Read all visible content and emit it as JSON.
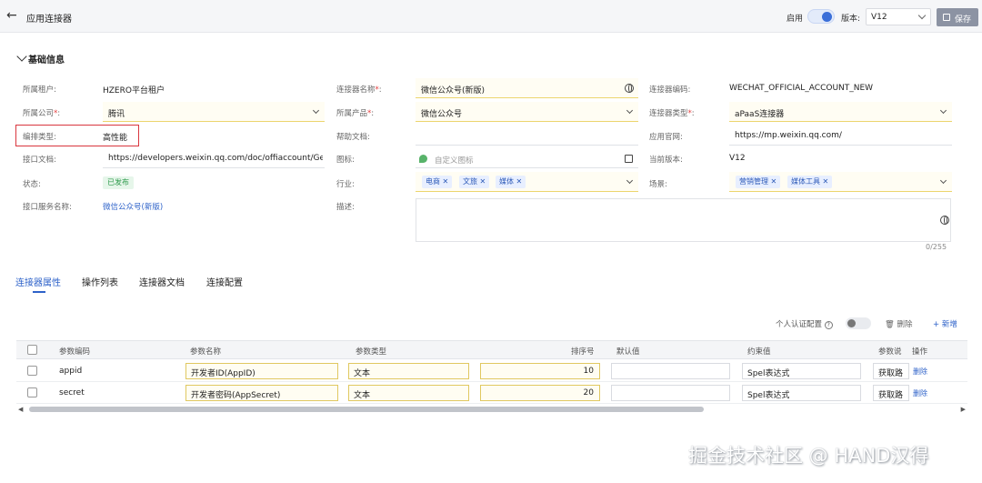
{
  "header": {
    "title": "应用连接器",
    "enable_label": "启用",
    "version_label": "版本:",
    "version_value": "V12",
    "save_label": "保存"
  },
  "section": {
    "title": "基础信息"
  },
  "fields": {
    "tenant": {
      "label": "所属租户:",
      "value": "HZERO平台租户"
    },
    "connector_name": {
      "label": "连接器名称",
      "value": "微信公众号(新版)"
    },
    "connector_code": {
      "label": "连接器编码:",
      "value": "WECHAT_OFFICIAL_ACCOUNT_NEW"
    },
    "company": {
      "label": "所属公司",
      "value": "腾讯"
    },
    "product": {
      "label": "所属产品",
      "value": "微信公众号"
    },
    "connector_type": {
      "label": "连接器类型",
      "value": "aPaaS连接器"
    },
    "orchestration_type": {
      "label": "编排类型:",
      "value": "高性能"
    },
    "help_doc": {
      "label": "帮助文档:"
    },
    "website": {
      "label": "应用官网:",
      "value": "https://mp.weixin.qq.com/"
    },
    "api_doc": {
      "label": "接口文档:",
      "value": "https://developers.weixin.qq.com/doc/offiaccount/Gettir"
    },
    "icon": {
      "label": "图标:",
      "placeholder": "自定义图标"
    },
    "current_version": {
      "label": "当前版本:",
      "value": "V12"
    },
    "status": {
      "label": "状态:",
      "value": "已发布"
    },
    "industry": {
      "label": "行业:",
      "tags": [
        "电商",
        "文旅",
        "媒体"
      ]
    },
    "scenario": {
      "label": "场景:",
      "tags": [
        "营销管理",
        "媒体工具"
      ]
    },
    "service_name": {
      "label": "接口服务名称:",
      "value": "微信公众号(新版)"
    },
    "description": {
      "label": "描述:",
      "counter": "0/255"
    }
  },
  "required_mark": "*",
  "colon": ":",
  "tabs": [
    "连接器属性",
    "操作列表",
    "连接器文档",
    "连接配置"
  ],
  "table_toolbar": {
    "personal_auth_label": "个人认证配置",
    "help_icon": "?",
    "delete_label": "删除",
    "new_label": "+ 新增"
  },
  "table": {
    "columns": [
      "参数编码",
      "参数名称",
      "参数类型",
      "排序号",
      "默认值",
      "约束值",
      "参数说",
      "操作"
    ],
    "rows": [
      {
        "code": "appid",
        "name": "开发者ID(AppID)",
        "type": "文本",
        "order": "10",
        "default": "",
        "constraint": "Spel表达式",
        "desc": "获取路",
        "action": "删除"
      },
      {
        "code": "secret",
        "name": "开发者密码(AppSecret)",
        "type": "文本",
        "order": "20",
        "default": "",
        "constraint": "Spel表达式",
        "desc": "获取路",
        "action": "删除"
      }
    ]
  },
  "watermark": "掘金技术社区 @ HAND汉得",
  "icons": [
    "back-arrow-icon",
    "save-icon",
    "globe-icon",
    "chevron-down-icon",
    "image-icon",
    "edit-icon",
    "trash-icon",
    "close-icon"
  ],
  "colors": {
    "accent": "#2e62c9",
    "required": "#e53e3e",
    "highlight_box": "#d9363e",
    "status_green": "#2e9a4c"
  }
}
